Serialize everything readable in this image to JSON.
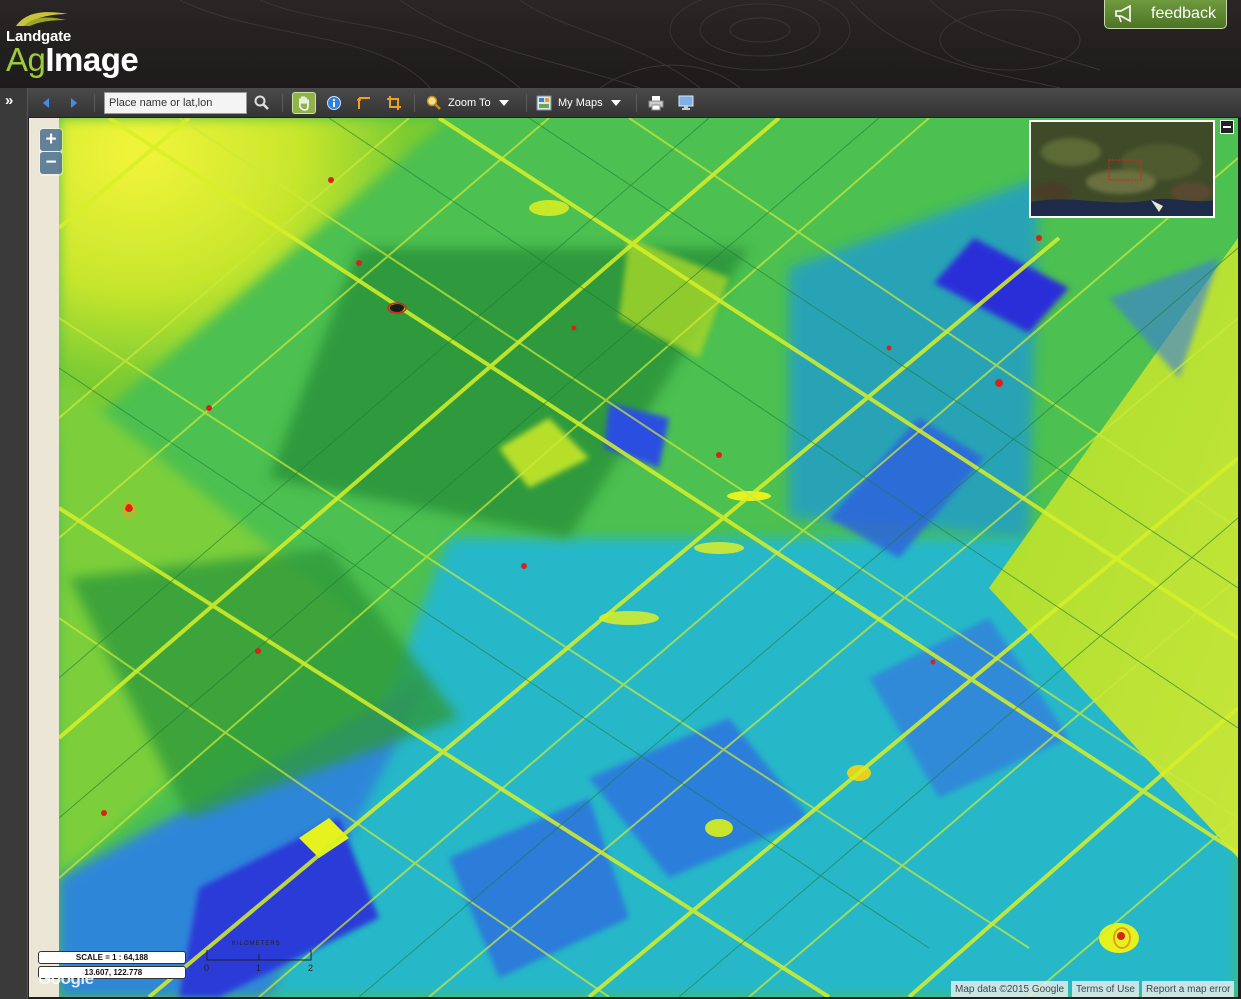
{
  "app": {
    "brand_top": "Landgate",
    "brand_ag": "Ag",
    "brand_image": "Image",
    "feedback_label": "feedback"
  },
  "toolbar": {
    "search_placeholder": "Place name or lat,lon",
    "zoom_to_label": "Zoom To",
    "my_maps_label": "My Maps"
  },
  "map": {
    "scale_text": "SCALE = 1 : 64,188",
    "coordinates_text": "-13.607, 122.778",
    "scalebar_title": "KILOMETERS",
    "scalebar_ticks": [
      "0",
      "1",
      "2"
    ],
    "google_logo": "Google",
    "attribution": "Map data ©2015 Google",
    "terms_link": "Terms of Use",
    "report_link": "Report a map error",
    "palette": {
      "yellow": "#e6f21e",
      "yellow_green": "#b3e02a",
      "dark_green": "#2f9a3a",
      "green": "#3fbf4a",
      "teal": "#23d29a",
      "cyan": "#1eb7d8",
      "blue": "#2f6fe0",
      "deep_blue": "#2a2fd8",
      "red": "#d8231c"
    }
  }
}
